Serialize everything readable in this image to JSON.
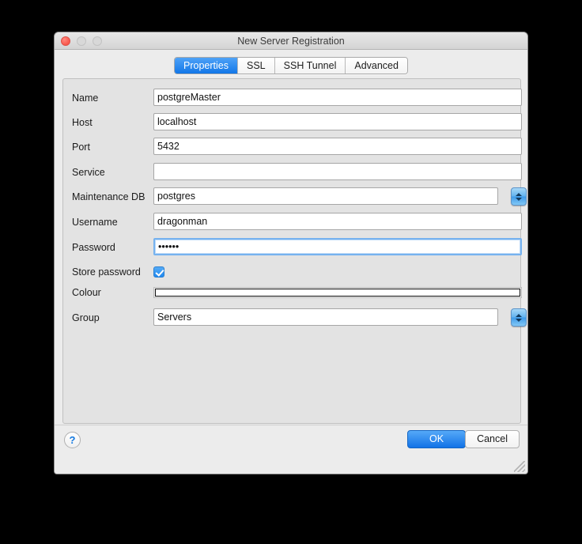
{
  "window": {
    "title": "New Server Registration",
    "traffic_lights": [
      "close-button",
      "minimize-button",
      "zoom-button"
    ]
  },
  "tabs": [
    {
      "label": "Properties",
      "active": true
    },
    {
      "label": "SSL",
      "active": false
    },
    {
      "label": "SSH Tunnel",
      "active": false
    },
    {
      "label": "Advanced",
      "active": false
    }
  ],
  "form": {
    "name": {
      "label": "Name",
      "value": "postgreMaster",
      "placeholder": ""
    },
    "host": {
      "label": "Host",
      "value": "localhost",
      "placeholder": ""
    },
    "port": {
      "label": "Port",
      "value": "5432",
      "placeholder": ""
    },
    "service": {
      "label": "Service",
      "value": "",
      "placeholder": ""
    },
    "maintenance_db": {
      "label": "Maintenance DB",
      "value": "postgres",
      "placeholder": ""
    },
    "username": {
      "label": "Username",
      "value": "dragonman",
      "placeholder": ""
    },
    "password": {
      "label": "Password",
      "value": "••••••",
      "placeholder": ""
    },
    "store_password": {
      "label": "Store password",
      "checked": true
    },
    "colour": {
      "label": "Colour",
      "value": "#ffffff"
    },
    "group": {
      "label": "Group",
      "value": "Servers",
      "placeholder": ""
    }
  },
  "footer": {
    "help_label": "?",
    "ok_label": "OK",
    "cancel_label": "Cancel"
  },
  "colors": {
    "accent": "#1272e6",
    "window_bg": "#ececec",
    "panel_bg": "#e3e3e3",
    "focus_ring": "#76b2ef"
  }
}
